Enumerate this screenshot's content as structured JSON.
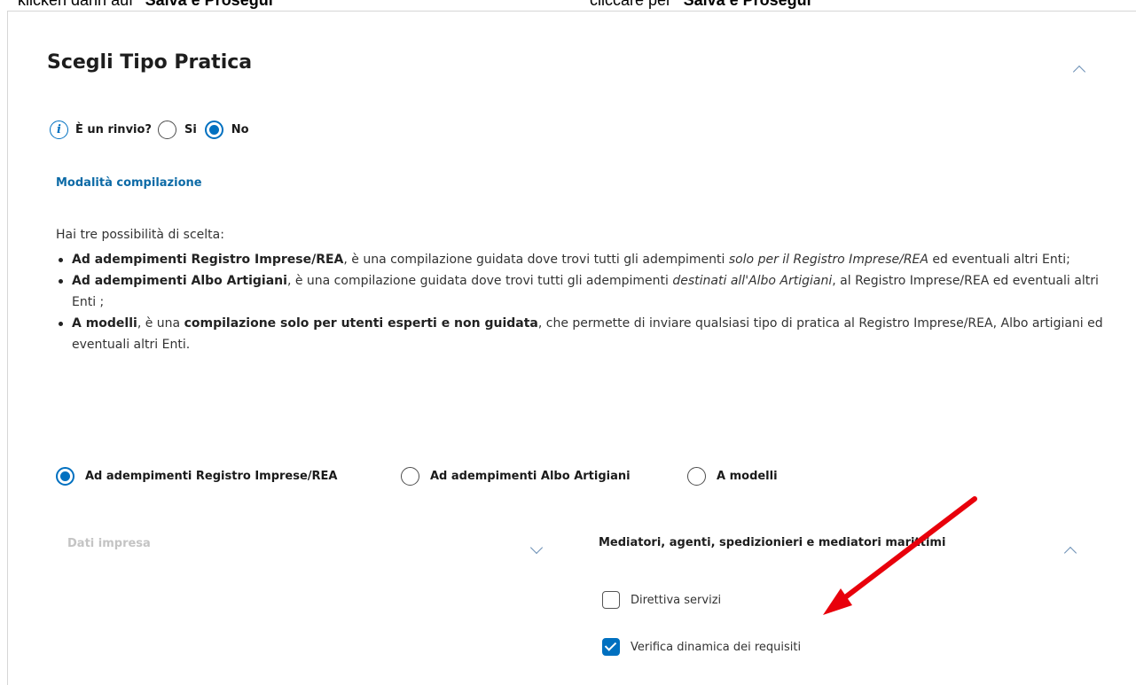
{
  "top_text": {
    "left_prefix": "klicken dann auf ",
    "left_bold": "\"Salva e Prosegui\"",
    "right_prefix": "cliccare per ",
    "right_bold": "\"Salva e Prosegui\""
  },
  "panel": {
    "title": "Scegli Tipo Pratica",
    "rinvio": {
      "question": "È un rinvio?",
      "options": [
        {
          "label": "Si",
          "selected": false
        },
        {
          "label": "No",
          "selected": true
        }
      ]
    },
    "mode_link": "Modalità compilazione",
    "intro": "Hai tre possibilità di scelta:",
    "bullets": [
      {
        "bold": "Ad adempimenti Registro Imprese/REA",
        "text1": ", è una compilazione guidata dove trovi tutti gli adempimenti ",
        "italic": "solo per il Registro Imprese/REA",
        "text2": " ed eventuali altri Enti;"
      },
      {
        "bold": "Ad adempimenti Albo Artigiani",
        "text1": ", è una compilazione guidata dove trovi tutti gli adempimenti ",
        "italic": "destinati all'Albo Artigiani",
        "text2": ", al Registro Imprese/REA ed eventuali altri Enti ;"
      },
      {
        "bold": "A modelli",
        "text1": ", è una ",
        "bold2": "compilazione solo per utenti esperti e non guidata",
        "text2": ", che permette di inviare qualsiasi tipo di pratica al Registro Imprese/REA, Albo artigiani ed eventuali altri Enti."
      }
    ],
    "modes": [
      {
        "label": "Ad adempimenti Registro Imprese/REA",
        "selected": true
      },
      {
        "label": "Ad adempimenti Albo Artigiani",
        "selected": false
      },
      {
        "label": "A modelli",
        "selected": false
      }
    ],
    "left_section": "Dati impresa",
    "right_section": "Mediatori, agenti, spedizionieri e mediatori marittimi",
    "checkboxes": [
      {
        "label": "Direttiva servizi",
        "checked": false
      },
      {
        "label": "Verifica dinamica dei requisiti",
        "checked": true
      }
    ]
  },
  "colors": {
    "accent": "#0070c0",
    "link": "#0c6aa6",
    "annotation_arrow": "#e8000b"
  }
}
